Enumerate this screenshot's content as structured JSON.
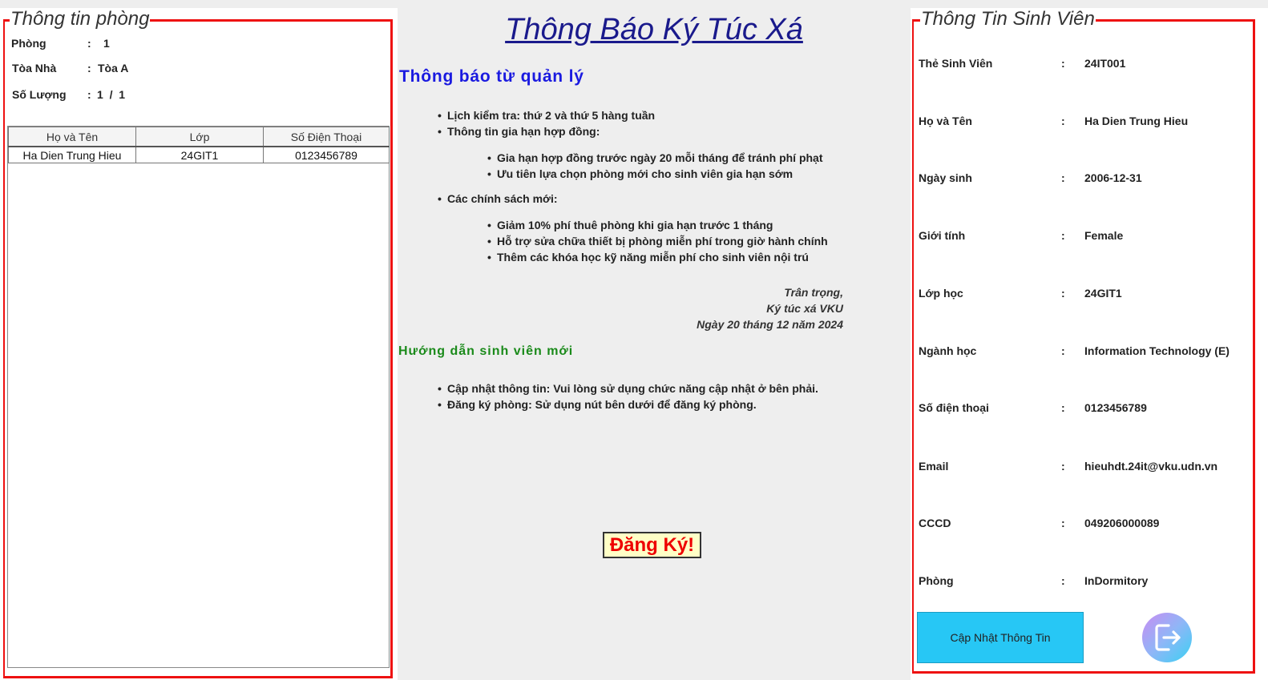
{
  "room_panel": {
    "legend": "Thông tin phòng",
    "room_label": "Phòng",
    "room_sep": ":",
    "room_value": "1",
    "building_label": "Tòa Nhà",
    "building_sep": ":",
    "building_value": "Tòa A",
    "count_label": "Số Lượng",
    "count_sep": ":",
    "count_value": "1  /  1",
    "table": {
      "headers": [
        "Họ và Tên",
        "Lớp",
        "Số Điện Thoại"
      ],
      "rows": [
        [
          "Ha Dien Trung Hieu",
          "24GIT1",
          "0123456789"
        ]
      ]
    }
  },
  "notice": {
    "title": "Thông Báo Ký Túc Xá",
    "section1_title": "Thông báo từ quản lý",
    "items": [
      "Lịch kiểm tra: thứ 2 và thứ 5 hàng tuần",
      "Thông tin gia hạn hợp đồng:",
      "Gia hạn hợp đồng trước ngày 20 mỗi tháng để tránh phí phạt",
      "Ưu tiên lựa chọn phòng mới cho sinh viên gia hạn sớm",
      "Các chính sách mới:",
      "Giảm 10% phí thuê phòng khi gia hạn trước 1 tháng",
      "Hỗ trợ sửa chữa thiết bị phòng miễn phí trong giờ hành chính",
      "Thêm các khóa học kỹ năng miễn phí cho sinh viên nội trú"
    ],
    "signature": [
      "Trân trọng,",
      "Ký túc xá VKU",
      "Ngày 20 tháng 12 năm 2024"
    ],
    "section2_title": "Hướng dẫn sinh viên mới",
    "guide_items": [
      "Cập nhật thông tin: Vui lòng sử dụng chức năng cập nhật ở bên phải.",
      "Đăng ký phòng: Sử dụng nút bên dưới để đăng ký phòng."
    ],
    "register_button": "Đăng Ký!"
  },
  "student_panel": {
    "legend": "Thông Tin Sinh Viên",
    "separator": ":",
    "fields": [
      {
        "label": "Thẻ Sinh Viên",
        "value": "24IT001"
      },
      {
        "label": "Họ và Tên",
        "value": "Ha Dien Trung Hieu"
      },
      {
        "label": "Ngày sinh",
        "value": "2006-12-31"
      },
      {
        "label": "Giới tính",
        "value": "Female"
      },
      {
        "label": "Lớp học",
        "value": "24GIT1"
      },
      {
        "label": "Ngành học",
        "value": "Information Technology (E)"
      },
      {
        "label": "Số điện thoại",
        "value": "0123456789"
      },
      {
        "label": "Email",
        "value": "hieuhdt.24it@vku.udn.vn"
      },
      {
        "label": "CCCD",
        "value": "049206000089"
      },
      {
        "label": "Phòng",
        "value": "InDormitory"
      }
    ],
    "update_button": "Cập Nhật Thông Tin",
    "logout_icon": "logout-icon"
  },
  "colors": {
    "frame": "#ee1111",
    "title": "#1a1a8c",
    "section1": "#1a1ae0",
    "section2": "#1a8a1a",
    "register_bg": "#ffffc6",
    "register_text": "#ee0000",
    "update_bg": "#27c7f5"
  }
}
